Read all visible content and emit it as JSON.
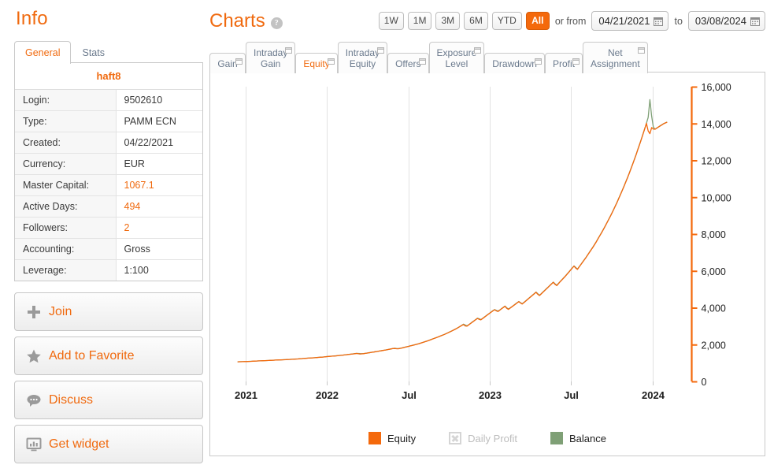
{
  "info": {
    "title": "Info",
    "tabs": [
      {
        "label": "General",
        "active": true
      },
      {
        "label": "Stats",
        "active": false
      }
    ],
    "account_name": "haft8",
    "rows": [
      {
        "key": "Login:",
        "value": "9502610",
        "highlight": false
      },
      {
        "key": "Type:",
        "value": "PAMM ECN",
        "highlight": false
      },
      {
        "key": "Created:",
        "value": "04/22/2021",
        "highlight": false
      },
      {
        "key": "Currency:",
        "value": "EUR",
        "highlight": false
      },
      {
        "key": "Master Capital:",
        "value": "1067.1",
        "highlight": true
      },
      {
        "key": "Active Days:",
        "value": "494",
        "highlight": true
      },
      {
        "key": "Followers:",
        "value": "2",
        "highlight": true
      },
      {
        "key": "Accounting:",
        "value": "Gross",
        "highlight": false
      },
      {
        "key": "Leverage:",
        "value": "1:100",
        "highlight": false
      }
    ],
    "buttons": [
      {
        "label": "Join",
        "icon": "plus-icon"
      },
      {
        "label": "Add to Favorite",
        "icon": "star-icon"
      },
      {
        "label": "Discuss",
        "icon": "speech-bubble-icon"
      },
      {
        "label": "Get widget",
        "icon": "widget-chart-icon"
      }
    ]
  },
  "charts": {
    "title": "Charts",
    "help_label": "?",
    "ranges": [
      {
        "label": "1W",
        "selected": false
      },
      {
        "label": "1M",
        "selected": false
      },
      {
        "label": "3M",
        "selected": false
      },
      {
        "label": "6M",
        "selected": false
      },
      {
        "label": "YTD",
        "selected": false
      },
      {
        "label": "All",
        "selected": true
      }
    ],
    "or_from_label": "or from",
    "to_label": "to",
    "date_from": "04/21/2021",
    "date_to": "03/08/2024",
    "tabs": [
      {
        "label": "Gain",
        "active": false
      },
      {
        "label": "Intraday Gain",
        "active": false
      },
      {
        "label": "Equity",
        "active": true
      },
      {
        "label": "Intraday Equity",
        "active": false
      },
      {
        "label": "Offers",
        "active": false
      },
      {
        "label": "Exposure Level",
        "active": false
      },
      {
        "label": "Drawdown",
        "active": false
      },
      {
        "label": "Profit",
        "active": false
      },
      {
        "label": "Net Assignment",
        "active": false
      }
    ]
  },
  "colors": {
    "accent_orange": "#f06a0f",
    "equity_line": "#f4690c",
    "balance_line": "#7fa076",
    "axis_orange": "#f4690c",
    "grid": "#dcdcdc",
    "border": "#c9c9c9"
  },
  "chart_data": {
    "type": "line",
    "title": "Equity",
    "xlabel": "",
    "ylabel": "",
    "grid": true,
    "legend_position": "bottom",
    "ylim": [
      0,
      16000
    ],
    "yticks": [
      0,
      2000,
      4000,
      6000,
      8000,
      10000,
      12000,
      14000,
      16000
    ],
    "ytick_labels": [
      "0",
      "2,000",
      "4,000",
      "6,000",
      "8,000",
      "10,000",
      "12,000",
      "14,000",
      "16,000"
    ],
    "xticks": [
      0.03,
      0.215,
      0.4,
      0.585,
      0.77,
      0.955
    ],
    "xtick_labels": [
      "2021",
      "2022",
      "Jul",
      "2023",
      "Jul",
      "2024"
    ],
    "legend": [
      {
        "name": "Equity",
        "color": "#f4690c",
        "visible": true
      },
      {
        "name": "Daily Profit",
        "color": "#d5d5d5",
        "visible": false
      },
      {
        "name": "Balance",
        "color": "#7fa076",
        "visible": true
      }
    ],
    "series": [
      {
        "name": "Balance",
        "color": "#7fa076",
        "values": [
          1067,
          1070,
          1072,
          1075,
          1078,
          1080,
          1085,
          1090,
          1095,
          1100,
          1105,
          1110,
          1115,
          1118,
          1122,
          1126,
          1130,
          1135,
          1140,
          1145,
          1150,
          1155,
          1160,
          1165,
          1168,
          1172,
          1176,
          1180,
          1185,
          1190,
          1195,
          1200,
          1206,
          1212,
          1218,
          1224,
          1230,
          1238,
          1246,
          1255,
          1262,
          1268,
          1272,
          1278,
          1285,
          1292,
          1300,
          1308,
          1316,
          1322,
          1330,
          1340,
          1350,
          1360,
          1368,
          1375,
          1382,
          1390,
          1400,
          1410,
          1420,
          1430,
          1440,
          1452,
          1465,
          1475,
          1486,
          1498,
          1510,
          1522,
          1520,
          1510,
          1505,
          1512,
          1525,
          1540,
          1555,
          1570,
          1586,
          1600,
          1615,
          1630,
          1648,
          1665,
          1680,
          1695,
          1712,
          1730,
          1748,
          1766,
          1785,
          1800,
          1790,
          1780,
          1795,
          1815,
          1838,
          1860,
          1882,
          1905,
          1928,
          1950,
          1975,
          2000,
          2025,
          2050,
          2080,
          2110,
          2140,
          2170,
          2200,
          2235,
          2270,
          2305,
          2340,
          2375,
          2410,
          2448,
          2485,
          2520,
          2560,
          2600,
          2645,
          2690,
          2735,
          2780,
          2830,
          2880,
          2935,
          2990,
          3050,
          3110,
          3060,
          3020,
          3080,
          3150,
          3220,
          3290,
          3360,
          3430,
          3400,
          3360,
          3420,
          3490,
          3560,
          3630,
          3700,
          3770,
          3840,
          3900,
          3860,
          3820,
          3880,
          3950,
          4020,
          4090,
          4000,
          3930,
          3990,
          4060,
          4130,
          4200,
          4270,
          4340,
          4280,
          4220,
          4290,
          4370,
          4450,
          4530,
          4610,
          4690,
          4770,
          4850,
          4760,
          4680,
          4760,
          4850,
          4940,
          5030,
          5120,
          5210,
          5300,
          5390,
          5300,
          5220,
          5320,
          5420,
          5520,
          5620,
          5720,
          5830,
          5940,
          6050,
          6160,
          6270,
          6180,
          6100,
          6220,
          6350,
          6480,
          6610,
          6740,
          6880,
          7020,
          7160,
          7300,
          7450,
          7600,
          7760,
          7920,
          8080,
          8250,
          8420,
          8600,
          8780,
          8960,
          9150,
          9340,
          9540,
          9740,
          9950,
          10160,
          10380,
          10600,
          10830,
          11060,
          11300,
          11550,
          11800,
          12060,
          12320,
          12590,
          12860,
          13140,
          13430,
          13720,
          14020,
          14330,
          15300,
          14400,
          13800,
          13700,
          13760,
          13820,
          13880,
          13940,
          14000,
          14040,
          14080
        ]
      },
      {
        "name": "Equity",
        "color": "#f4690c",
        "values": [
          1067,
          1068,
          1070,
          1072,
          1076,
          1078,
          1082,
          1088,
          1092,
          1098,
          1102,
          1108,
          1112,
          1116,
          1120,
          1124,
          1128,
          1132,
          1138,
          1142,
          1148,
          1152,
          1158,
          1162,
          1166,
          1170,
          1174,
          1178,
          1182,
          1188,
          1192,
          1198,
          1203,
          1209,
          1215,
          1221,
          1227,
          1235,
          1243,
          1252,
          1259,
          1265,
          1270,
          1275,
          1282,
          1289,
          1297,
          1305,
          1313,
          1319,
          1327,
          1337,
          1347,
          1357,
          1365,
          1372,
          1379,
          1387,
          1397,
          1407,
          1417,
          1427,
          1437,
          1449,
          1462,
          1472,
          1483,
          1495,
          1507,
          1519,
          1500,
          1490,
          1498,
          1508,
          1522,
          1537,
          1552,
          1567,
          1583,
          1597,
          1612,
          1627,
          1645,
          1662,
          1677,
          1692,
          1709,
          1727,
          1745,
          1763,
          1782,
          1790,
          1775,
          1770,
          1790,
          1810,
          1833,
          1855,
          1877,
          1900,
          1923,
          1945,
          1970,
          1995,
          2020,
          2045,
          2075,
          2105,
          2135,
          2165,
          2195,
          2230,
          2265,
          2300,
          2335,
          2370,
          2405,
          2443,
          2480,
          2515,
          2555,
          2595,
          2640,
          2685,
          2730,
          2775,
          2825,
          2875,
          2930,
          2985,
          3040,
          3090,
          3010,
          3000,
          3070,
          3140,
          3210,
          3280,
          3350,
          3420,
          3370,
          3340,
          3410,
          3480,
          3550,
          3620,
          3690,
          3760,
          3830,
          3890,
          3830,
          3800,
          3870,
          3940,
          4010,
          4080,
          3970,
          3910,
          3980,
          4050,
          4120,
          4190,
          4260,
          4330,
          4260,
          4200,
          4280,
          4360,
          4440,
          4520,
          4600,
          4680,
          4760,
          4840,
          4730,
          4660,
          4750,
          4840,
          4930,
          5020,
          5110,
          5200,
          5290,
          5380,
          5270,
          5200,
          5310,
          5410,
          5510,
          5610,
          5710,
          5820,
          5930,
          6040,
          6150,
          6260,
          6150,
          6080,
          6210,
          6340,
          6470,
          6600,
          6730,
          6870,
          7010,
          7150,
          7290,
          7440,
          7590,
          7750,
          7910,
          8070,
          8240,
          8410,
          8590,
          8770,
          8950,
          9140,
          9330,
          9530,
          9730,
          9940,
          10150,
          10370,
          10590,
          10820,
          11050,
          11290,
          11540,
          11790,
          12050,
          12310,
          12580,
          12850,
          13130,
          13420,
          13710,
          14010,
          13600,
          13450,
          13780,
          13700,
          13690,
          13750,
          13810,
          13870,
          13930,
          13990,
          14030,
          14070
        ]
      }
    ]
  }
}
